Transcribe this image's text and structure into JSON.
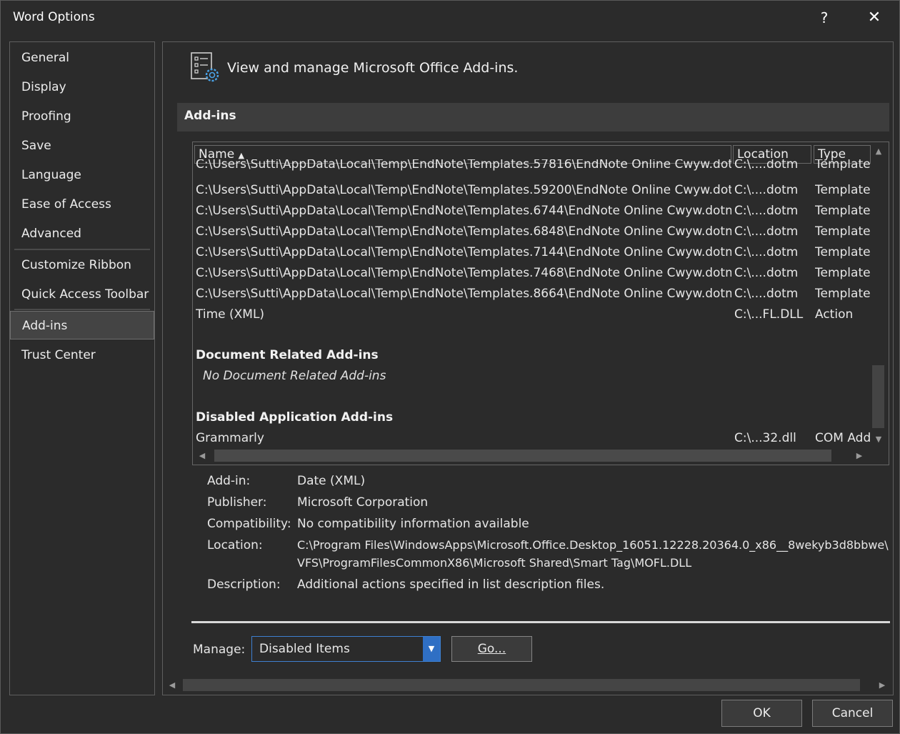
{
  "window": {
    "title": "Word Options",
    "help_label": "?",
    "close_label": "✕"
  },
  "sidebar": {
    "items": [
      {
        "label": "General"
      },
      {
        "label": "Display"
      },
      {
        "label": "Proofing"
      },
      {
        "label": "Save"
      },
      {
        "label": "Language"
      },
      {
        "label": "Ease of Access"
      },
      {
        "label": "Advanced"
      },
      {
        "label": "Customize Ribbon"
      },
      {
        "label": "Quick Access Toolbar"
      },
      {
        "label": "Add-ins",
        "selected": true
      },
      {
        "label": "Trust Center"
      }
    ]
  },
  "header": {
    "icon": "addins-settings-icon",
    "text": "View and manage Microsoft Office Add-ins."
  },
  "section": {
    "title": "Add-ins"
  },
  "list": {
    "columns": {
      "name": "Name",
      "location": "Location",
      "type": "Type"
    },
    "rows": [
      {
        "name": "C:\\Users\\Sutti\\AppData\\Local\\Temp\\EndNote\\Templates.57816\\EndNote Online Cwyw.dotm",
        "location": "C:\\....dotm",
        "type": "Template"
      },
      {
        "name": "C:\\Users\\Sutti\\AppData\\Local\\Temp\\EndNote\\Templates.59200\\EndNote Online Cwyw.dotm",
        "location": "C:\\....dotm",
        "type": "Template"
      },
      {
        "name": "C:\\Users\\Sutti\\AppData\\Local\\Temp\\EndNote\\Templates.6744\\EndNote Online Cwyw.dotm",
        "location": "C:\\....dotm",
        "type": "Template"
      },
      {
        "name": "C:\\Users\\Sutti\\AppData\\Local\\Temp\\EndNote\\Templates.6848\\EndNote Online Cwyw.dotm",
        "location": "C:\\....dotm",
        "type": "Template"
      },
      {
        "name": "C:\\Users\\Sutti\\AppData\\Local\\Temp\\EndNote\\Templates.7144\\EndNote Online Cwyw.dotm",
        "location": "C:\\....dotm",
        "type": "Template"
      },
      {
        "name": "C:\\Users\\Sutti\\AppData\\Local\\Temp\\EndNote\\Templates.7468\\EndNote Online Cwyw.dotm",
        "location": "C:\\....dotm",
        "type": "Template"
      },
      {
        "name": "C:\\Users\\Sutti\\AppData\\Local\\Temp\\EndNote\\Templates.8664\\EndNote Online Cwyw.dotm",
        "location": "C:\\....dotm",
        "type": "Template"
      },
      {
        "name": "Time (XML)",
        "location": "C:\\...FL.DLL",
        "type": "Action"
      }
    ],
    "doc_group_title": "Document Related Add-ins",
    "doc_group_empty": "No Document Related Add-ins",
    "disabled_group_title": "Disabled Application Add-ins",
    "disabled_rows": [
      {
        "name": "Grammarly",
        "location": "C:\\...32.dll",
        "type": "COM Add-in"
      }
    ]
  },
  "details": {
    "addin_label": "Add-in:",
    "addin_value": "Date (XML)",
    "publisher_label": "Publisher:",
    "publisher_value": "Microsoft Corporation",
    "compat_label": "Compatibility:",
    "compat_value": "No compatibility information available",
    "location_label": "Location:",
    "location_value_line1": "C:\\Program Files\\WindowsApps\\Microsoft.Office.Desktop_16051.12228.20364.0_x86__8wekyb3d8bbwe\\",
    "location_value_line2": "VFS\\ProgramFilesCommonX86\\Microsoft Shared\\Smart Tag\\MOFL.DLL",
    "description_label": "Description:",
    "description_value": "Additional actions specified in list description files."
  },
  "manage": {
    "label": "Manage:",
    "selected": "Disabled Items",
    "go_label": "Go..."
  },
  "buttons": {
    "ok": "OK",
    "cancel": "Cancel"
  }
}
